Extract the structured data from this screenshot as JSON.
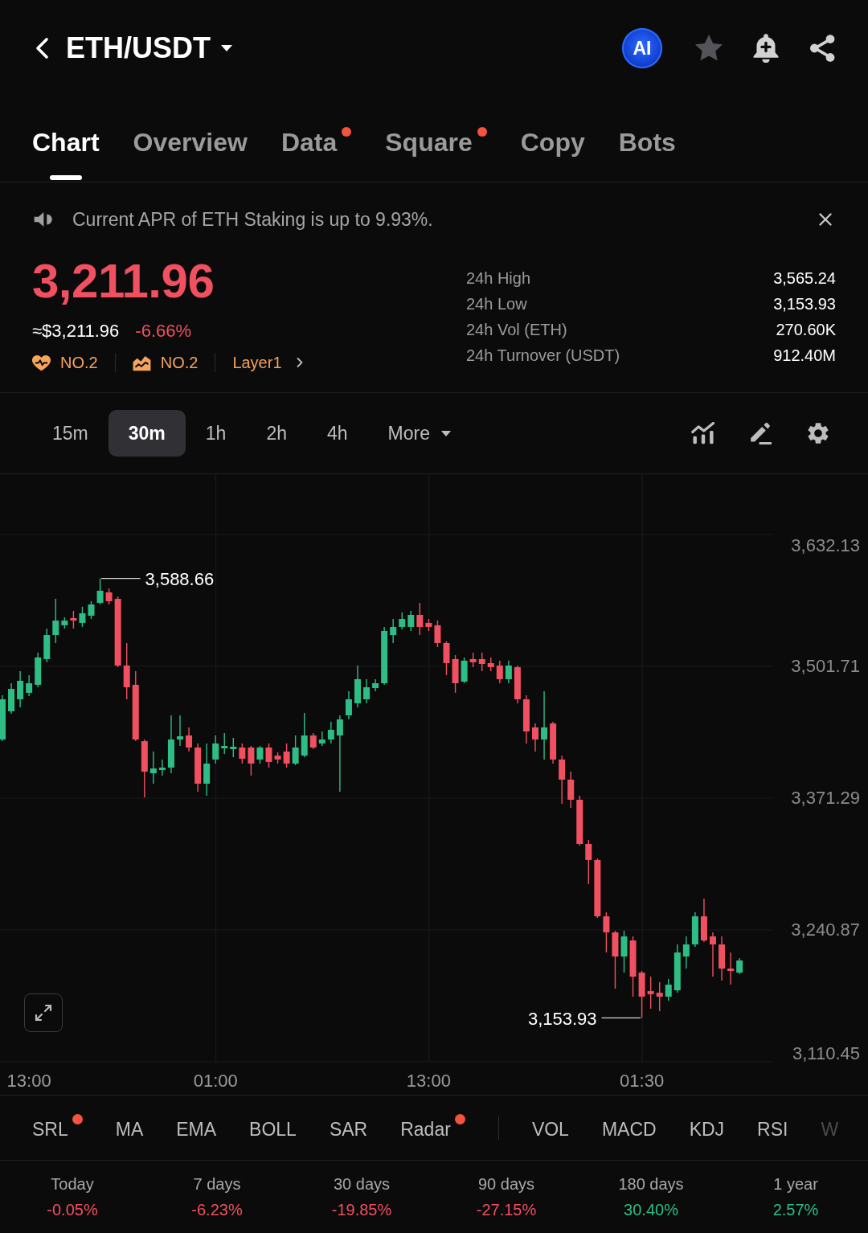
{
  "header": {
    "title": "ETH/USDT",
    "ai_badge": "AI"
  },
  "tabs": [
    {
      "label": "Chart",
      "selected": true,
      "dot": false
    },
    {
      "label": "Overview",
      "selected": false,
      "dot": false
    },
    {
      "label": "Data",
      "selected": false,
      "dot": true
    },
    {
      "label": "Square",
      "selected": false,
      "dot": true
    },
    {
      "label": "Copy",
      "selected": false,
      "dot": false
    },
    {
      "label": "Bots",
      "selected": false,
      "dot": false
    }
  ],
  "notice": {
    "text": "Current APR of ETH Staking is up to 9.93%."
  },
  "price": {
    "last": "3,211.96",
    "fiat": "≈$3,211.96",
    "change": "-6.66%",
    "negative": true
  },
  "tags": [
    {
      "kind": "popularity",
      "text": "NO.2"
    },
    {
      "kind": "gainers",
      "text": "NO.2"
    },
    {
      "kind": "sector",
      "text": "Layer1"
    }
  ],
  "stats": [
    {
      "label": "24h High",
      "value": "3,565.24"
    },
    {
      "label": "24h Low",
      "value": "3,153.93"
    },
    {
      "label": "24h Vol (ETH)",
      "value": "270.60K"
    },
    {
      "label": "24h Turnover (USDT)",
      "value": "912.40M"
    }
  ],
  "timeframes": [
    {
      "label": "15m",
      "selected": false
    },
    {
      "label": "30m",
      "selected": true
    },
    {
      "label": "1h",
      "selected": false
    },
    {
      "label": "2h",
      "selected": false
    },
    {
      "label": "4h",
      "selected": false
    }
  ],
  "more_menu": {
    "label": "More"
  },
  "chart": {
    "chart_data": {
      "type": "candlestick",
      "categories": [
        null,
        null,
        null,
        "13:00",
        null,
        null,
        null,
        null,
        null,
        null,
        null,
        null,
        null,
        null,
        null,
        null,
        null,
        null,
        null,
        null,
        null,
        null,
        null,
        null,
        "01:00",
        null,
        null,
        null,
        null,
        null,
        null,
        null,
        null,
        null,
        null,
        null,
        null,
        null,
        null,
        null,
        null,
        null,
        null,
        null,
        null,
        null,
        null,
        null,
        "13:00",
        null,
        null,
        null,
        null,
        null,
        null,
        null,
        null,
        null,
        null,
        null,
        null,
        null,
        null,
        null,
        null,
        null,
        null,
        null,
        null,
        null,
        null,
        null,
        "01:30",
        null,
        null,
        null,
        null,
        null,
        null,
        null,
        null,
        null,
        null,
        null
      ],
      "ohlc": [
        [
          3429.3,
          3473.1,
          3427.7,
          3469.1
        ],
        [
          3457.2,
          3485.0,
          3454.8,
          3479.4
        ],
        [
          3469.1,
          3496.9,
          3461.2,
          3487.4
        ],
        [
          3475.5,
          3493.0,
          3472.3,
          3485.0
        ],
        [
          3483.4,
          3515.2,
          3481.0,
          3510.5
        ],
        [
          3508.9,
          3539.1,
          3505.7,
          3532.7
        ],
        [
          3532.7,
          3568.5,
          3524.8,
          3547.0
        ],
        [
          3542.3,
          3550.2,
          3539.1,
          3547.0
        ],
        [
          3549.4,
          3556.6,
          3539.1,
          3547.0
        ],
        [
          3544.7,
          3560.6,
          3540.7,
          3554.2
        ],
        [
          3551.8,
          3566.1,
          3548.6,
          3562.9
        ],
        [
          3564.5,
          3588.66,
          3562.9,
          3576.5
        ],
        [
          3574.9,
          3578.8,
          3562.9,
          3566.1
        ],
        [
          3568.5,
          3570.9,
          3500.9,
          3502.5
        ],
        [
          3502.5,
          3524.8,
          3469.1,
          3481.0
        ],
        [
          3483.4,
          3496.9,
          3427.7,
          3429.3
        ],
        [
          3427.7,
          3429.3,
          3372.1,
          3397.5
        ],
        [
          3395.9,
          3417.4,
          3385.6,
          3400.7
        ],
        [
          3399.1,
          3409.5,
          3393.6,
          3401.5
        ],
        [
          3401.5,
          3453.2,
          3395.9,
          3429.3
        ],
        [
          3429.3,
          3453.2,
          3423.0,
          3432.5
        ],
        [
          3433.3,
          3441.3,
          3417.4,
          3421.4
        ],
        [
          3421.4,
          3425.4,
          3377.6,
          3385.6
        ],
        [
          3385.6,
          3425.4,
          3373.7,
          3405.5
        ],
        [
          3409.5,
          3433.3,
          3405.5,
          3425.4
        ],
        [
          3420.6,
          3435.7,
          3415.0,
          3423.0
        ],
        [
          3419.8,
          3430.9,
          3411.8,
          3422.2
        ],
        [
          3421.4,
          3425.4,
          3405.5,
          3410.3
        ],
        [
          3421.4,
          3423.0,
          3393.6,
          3405.5
        ],
        [
          3409.5,
          3423.0,
          3405.5,
          3421.4
        ],
        [
          3421.4,
          3425.4,
          3401.5,
          3407.1
        ],
        [
          3413.4,
          3416.6,
          3405.5,
          3409.5
        ],
        [
          3417.4,
          3425.4,
          3401.5,
          3405.5
        ],
        [
          3405.5,
          3433.3,
          3403.9,
          3421.4
        ],
        [
          3413.4,
          3455.6,
          3411.8,
          3433.3
        ],
        [
          3433.3,
          3435.7,
          3419.8,
          3421.4
        ],
        [
          3425.4,
          3437.3,
          3423.0,
          3429.3
        ],
        [
          3429.3,
          3446.8,
          3425.4,
          3438.9
        ],
        [
          3433.3,
          3453.2,
          3377.6,
          3449.2
        ],
        [
          3453.2,
          3477.1,
          3449.2,
          3469.1
        ],
        [
          3465.1,
          3502.5,
          3461.2,
          3489.0
        ],
        [
          3469.1,
          3489.0,
          3465.1,
          3481.0
        ],
        [
          3480.2,
          3489.0,
          3477.1,
          3485.0
        ],
        [
          3485.0,
          3540.7,
          3483.4,
          3536.7
        ],
        [
          3532.7,
          3548.6,
          3524.8,
          3540.7
        ],
        [
          3540.7,
          3555.0,
          3538.3,
          3548.6
        ],
        [
          3540.7,
          3556.6,
          3536.7,
          3552.6
        ],
        [
          3552.6,
          3564.5,
          3532.7,
          3540.7
        ],
        [
          3544.7,
          3548.6,
          3536.7,
          3540.7
        ],
        [
          3542.3,
          3547.0,
          3520.8,
          3524.8
        ],
        [
          3524.8,
          3526.4,
          3493.0,
          3504.9
        ],
        [
          3508.9,
          3512.8,
          3475.5,
          3485.0
        ],
        [
          3486.6,
          3510.5,
          3485.0,
          3507.3
        ],
        [
          3508.9,
          3515.2,
          3500.9,
          3505.7
        ],
        [
          3508.9,
          3515.2,
          3496.9,
          3504.1
        ],
        [
          3504.9,
          3510.5,
          3496.9,
          3500.9
        ],
        [
          3502.5,
          3507.3,
          3485.0,
          3489.0
        ],
        [
          3489.0,
          3507.3,
          3485.0,
          3502.5
        ],
        [
          3500.9,
          3502.5,
          3465.1,
          3469.1
        ],
        [
          3469.1,
          3473.1,
          3425.4,
          3437.3
        ],
        [
          3441.3,
          3445.2,
          3417.4,
          3429.3
        ],
        [
          3429.3,
          3477.1,
          3409.5,
          3441.3
        ],
        [
          3445.2,
          3446.8,
          3405.5,
          3409.5
        ],
        [
          3409.5,
          3413.4,
          3365.7,
          3389.6
        ],
        [
          3389.6,
          3397.5,
          3361.7,
          3369.7
        ],
        [
          3369.7,
          3373.7,
          3324.4,
          3326.0
        ],
        [
          3326.0,
          3329.9,
          3286.2,
          3310.1
        ],
        [
          3310.1,
          3311.6,
          3252.8,
          3254.4
        ],
        [
          3254.4,
          3258.4,
          3218.6,
          3238.5
        ],
        [
          3238.5,
          3240.1,
          3182.8,
          3214.6
        ],
        [
          3214.6,
          3240.1,
          3198.7,
          3234.5
        ],
        [
          3230.5,
          3234.5,
          3174.9,
          3194.7
        ],
        [
          3198.7,
          3200.3,
          3153.93,
          3174.9
        ],
        [
          3180.4,
          3194.7,
          3162.9,
          3177.3
        ],
        [
          3178.8,
          3189.2,
          3160.6,
          3174.9
        ],
        [
          3174.9,
          3192.4,
          3170.9,
          3186.8
        ],
        [
          3181.2,
          3226.6,
          3178.8,
          3218.6
        ],
        [
          3214.6,
          3234.5,
          3202.7,
          3226.6
        ],
        [
          3226.6,
          3258.4,
          3224.2,
          3254.4
        ],
        [
          3254.4,
          3271.9,
          3228.9,
          3230.5
        ],
        [
          3234.5,
          3238.5,
          3194.7,
          3226.6
        ],
        [
          3226.6,
          3234.5,
          3190.8,
          3202.7
        ],
        [
          3202.7,
          3218.6,
          3186.8,
          3200.3
        ],
        [
          3198.7,
          3213.0,
          3197.1,
          3210.7
        ]
      ],
      "ylim": [
        3110.45,
        3691.77
      ],
      "yticks": [
        {
          "value": 3632.13,
          "label": "3,632.13"
        },
        {
          "value": 3501.71,
          "label": "3,501.71"
        },
        {
          "value": 3371.29,
          "label": "3,371.29"
        },
        {
          "value": 3240.87,
          "label": "3,240.87"
        },
        {
          "value": 3110.45,
          "label": "3,110.45"
        }
      ],
      "grid": true,
      "annotations": [
        "3,588.66",
        "3,153.93"
      ]
    }
  },
  "main_indicators": [
    {
      "label": "SRL",
      "dot": true
    },
    {
      "label": "MA",
      "dot": false
    },
    {
      "label": "EMA",
      "dot": false
    },
    {
      "label": "BOLL",
      "dot": false
    },
    {
      "label": "SAR",
      "dot": false
    },
    {
      "label": "Radar",
      "dot": true
    }
  ],
  "sub_indicators": [
    {
      "label": "VOL",
      "faded": false
    },
    {
      "label": "MACD",
      "faded": false
    },
    {
      "label": "KDJ",
      "faded": false
    },
    {
      "label": "RSI",
      "faded": false
    },
    {
      "label": "W",
      "faded": true
    }
  ],
  "periods": [
    {
      "label": "Today",
      "value": "-0.05%",
      "negative": true
    },
    {
      "label": "7 days",
      "value": "-6.23%",
      "negative": true
    },
    {
      "label": "30 days",
      "value": "-19.85%",
      "negative": true
    },
    {
      "label": "90 days",
      "value": "-27.15%",
      "negative": true
    },
    {
      "label": "180 days",
      "value": "30.40%",
      "negative": false
    },
    {
      "label": "1 year",
      "value": "2.57%",
      "negative": false
    }
  ]
}
